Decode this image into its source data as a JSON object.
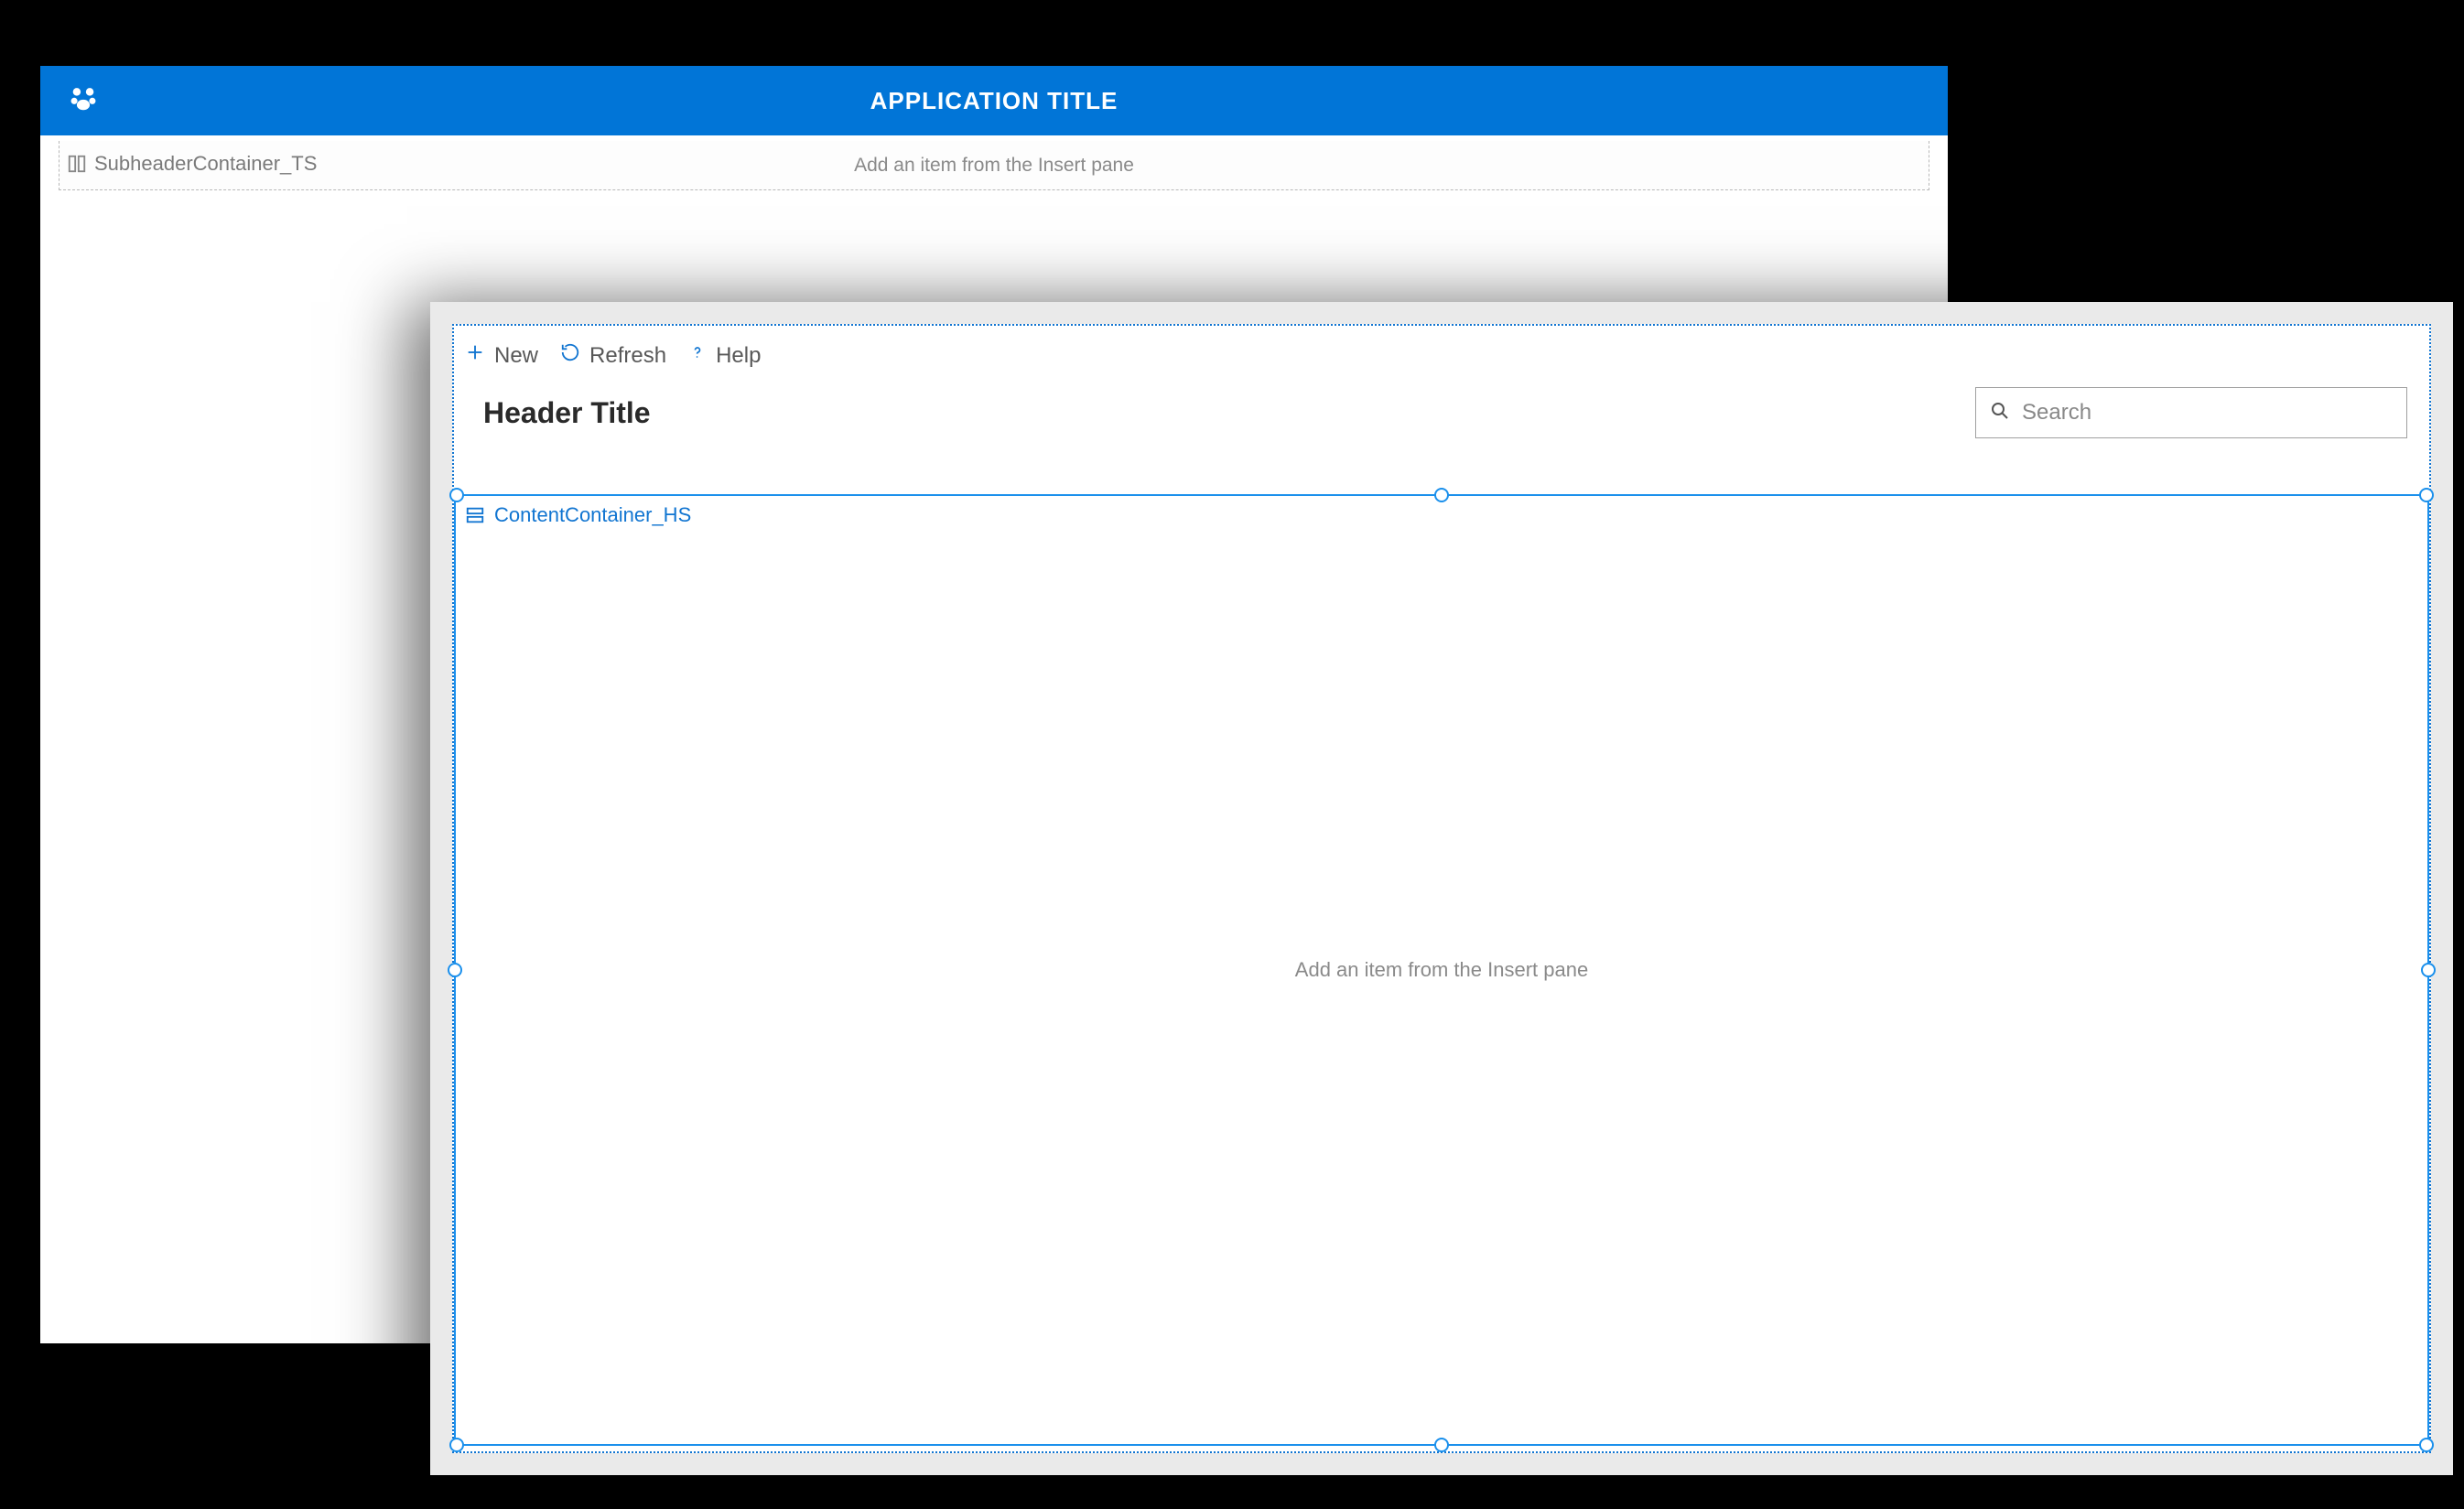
{
  "back_window": {
    "title": "APPLICATION TITLE",
    "subheader_container_name": "SubheaderContainer_TS",
    "subheader_placeholder": "Add an item from the Insert pane"
  },
  "front_window": {
    "commands": {
      "new": "New",
      "refresh": "Refresh",
      "help": "Help"
    },
    "header_title": "Header Title",
    "search_placeholder": "Search",
    "content_container_name": "ContentContainer_HS",
    "content_placeholder": "Add an item from the Insert pane"
  },
  "colors": {
    "brand_blue": "#0175d7",
    "selection_blue": "#1b90ec"
  }
}
